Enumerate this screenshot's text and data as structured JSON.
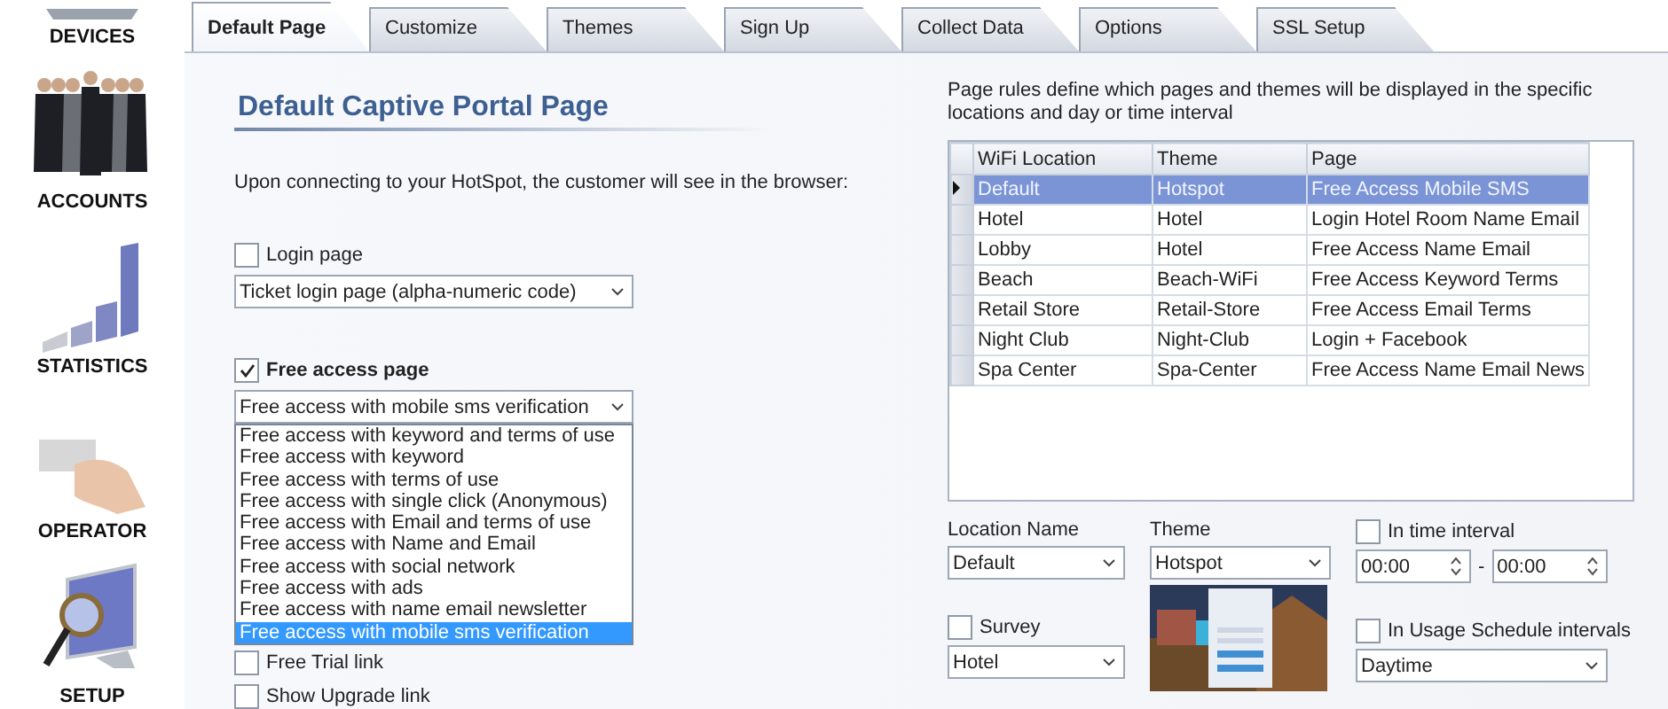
{
  "sidebar": {
    "items": [
      {
        "kind": "devices",
        "label": "DEVICES"
      },
      {
        "kind": "accounts",
        "label": "ACCOUNTS"
      },
      {
        "kind": "statistics",
        "label": "STATISTICS"
      },
      {
        "kind": "operator",
        "label": "OPERATOR"
      },
      {
        "kind": "setup",
        "label": "SETUP"
      }
    ]
  },
  "tabs": [
    {
      "label": "Default Page",
      "selected": true
    },
    {
      "label": "Customize",
      "selected": false
    },
    {
      "label": "Themes",
      "selected": false
    },
    {
      "label": "Sign Up",
      "selected": false
    },
    {
      "label": "Collect Data",
      "selected": false
    },
    {
      "label": "Options",
      "selected": false
    },
    {
      "label": "SSL Setup",
      "selected": false
    }
  ],
  "left": {
    "heading": "Default Captive Portal Page",
    "intro": "Upon connecting to your HotSpot, the customer will see in the browser:",
    "login_page": {
      "label": "Login page",
      "checked": false,
      "value": "Ticket login page (alpha-numeric code)"
    },
    "free_access": {
      "label": "Free access page",
      "checked": true,
      "value": "Free access with mobile sms verification",
      "expanded": true,
      "options": [
        {
          "label": "Free access with keyword and terms of use",
          "selected": false
        },
        {
          "label": "Free access with keyword",
          "selected": false
        },
        {
          "label": "Free access with terms of use",
          "selected": false
        },
        {
          "label": "Free access with single click (Anonymous)",
          "selected": false
        },
        {
          "label": "Free access with Email and terms of use",
          "selected": false
        },
        {
          "label": "Free access with Name and Email",
          "selected": false
        },
        {
          "label": "Free access with social network",
          "selected": false
        },
        {
          "label": "Free access with ads",
          "selected": false
        },
        {
          "label": "Free access with name email newsletter",
          "selected": false
        },
        {
          "label": "Free access with mobile sms verification",
          "selected": true
        }
      ]
    },
    "free_trial": {
      "label": "Free Trial link",
      "checked": false
    },
    "show_upgrade": {
      "label": "Show Upgrade link",
      "checked": false
    }
  },
  "right": {
    "description": "Page rules define which pages and themes will be displayed in the specific locations and day or time interval",
    "table": {
      "columns": [
        "WiFi Location",
        "Theme",
        "Page"
      ],
      "rows": [
        {
          "cells": [
            "Default",
            "Hotspot",
            "Free Access Mobile SMS"
          ],
          "selected": true
        },
        {
          "cells": [
            "Hotel",
            "Hotel",
            "Login Hotel Room Name Email"
          ],
          "selected": false
        },
        {
          "cells": [
            "Lobby",
            "Hotel",
            "Free Access Name Email"
          ],
          "selected": false
        },
        {
          "cells": [
            "Beach",
            "Beach-WiFi",
            "Free Access Keyword Terms"
          ],
          "selected": false
        },
        {
          "cells": [
            "Retail Store",
            "Retail-Store",
            "Free Access Email Terms"
          ],
          "selected": false
        },
        {
          "cells": [
            "Night Club",
            "Night-Club",
            "Login + Facebook"
          ],
          "selected": false
        },
        {
          "cells": [
            "Spa Center",
            "Spa-Center",
            "Free Access Name Email News"
          ],
          "selected": false
        }
      ]
    },
    "location_name": {
      "label": "Location Name",
      "value": "Default"
    },
    "theme": {
      "label": "Theme",
      "value": "Hotspot"
    },
    "survey": {
      "label": "Survey",
      "checked": false,
      "value": "Hotel"
    },
    "time_interval": {
      "label": "In time interval",
      "checked": false,
      "from": "00:00",
      "separator": "-",
      "to": "00:00"
    },
    "usage_schedule": {
      "label": "In Usage Schedule intervals",
      "checked": false,
      "value": "Daytime"
    }
  }
}
